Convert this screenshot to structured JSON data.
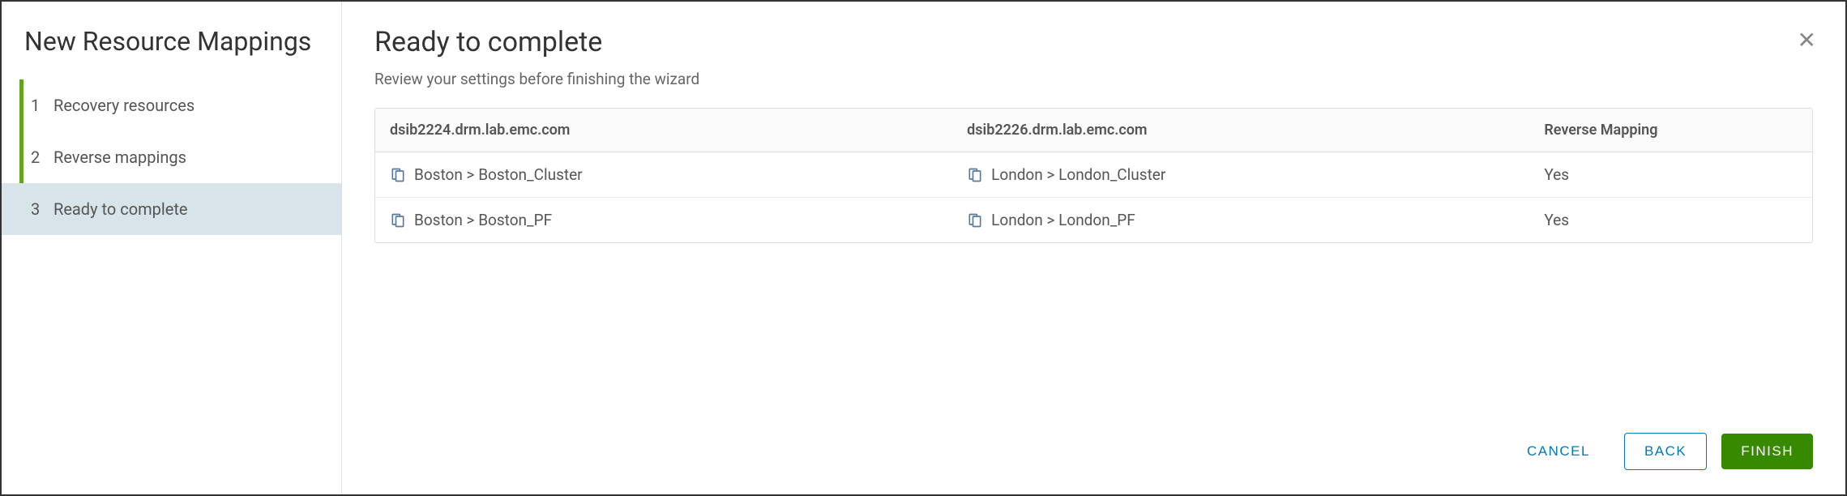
{
  "sidebar": {
    "title": "New Resource Mappings",
    "steps": [
      {
        "number": "1",
        "label": "Recovery resources"
      },
      {
        "number": "2",
        "label": "Reverse mappings"
      },
      {
        "number": "3",
        "label": "Ready to complete"
      }
    ]
  },
  "main": {
    "title": "Ready to complete",
    "subtitle": "Review your settings before finishing the wizard",
    "table": {
      "headers": {
        "source": "dsib2224.drm.lab.emc.com",
        "target": "dsib2226.drm.lab.emc.com",
        "reverse": "Reverse Mapping"
      },
      "rows": [
        {
          "source": "Boston > Boston_Cluster",
          "target": "London > London_Cluster",
          "reverse": "Yes"
        },
        {
          "source": "Boston > Boston_PF",
          "target": "London > London_PF",
          "reverse": "Yes"
        }
      ]
    }
  },
  "footer": {
    "cancel": "CANCEL",
    "back": "BACK",
    "finish": "FINISH"
  }
}
